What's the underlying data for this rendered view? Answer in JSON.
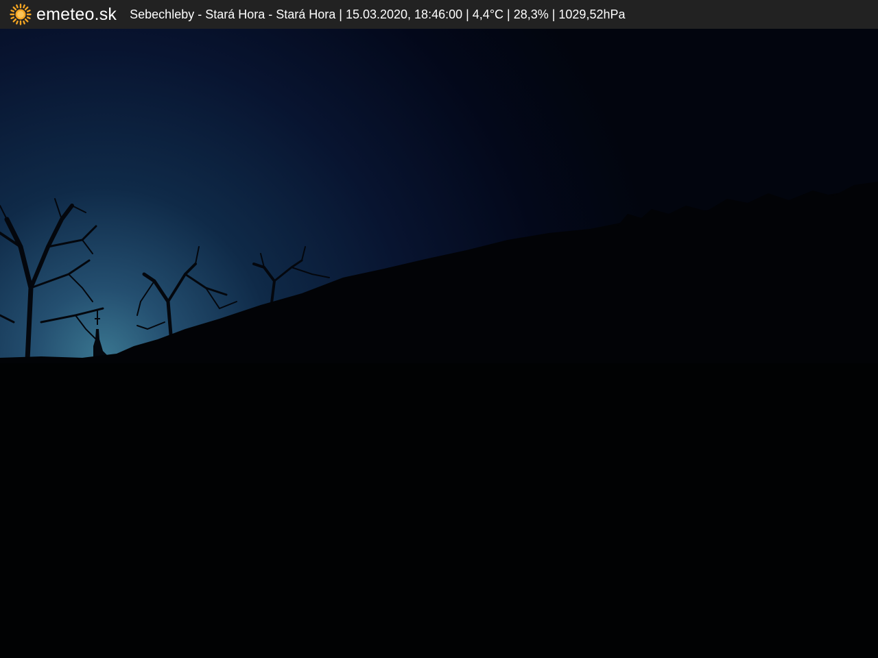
{
  "header": {
    "brand": "emeteo.sk",
    "icon": "sun-icon",
    "info": "Sebechleby - Stará Hora - Stará Hora | 15.03.2020, 18:46:00 | 4,4°C | 28,3% | 1029,52hPa"
  },
  "colors": {
    "header_bg": "#222222",
    "sun": "#f5a623",
    "sky_top": "#04081a",
    "sky_horizon": "#2f6180"
  }
}
